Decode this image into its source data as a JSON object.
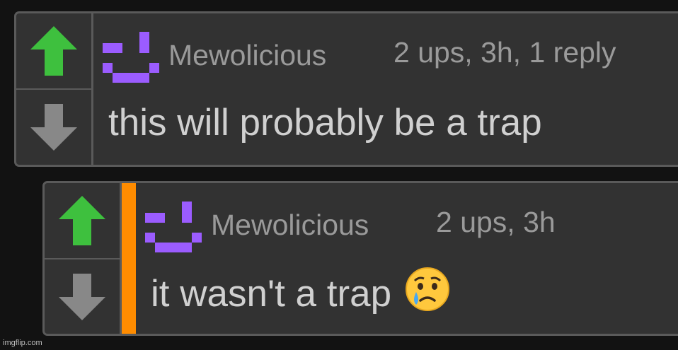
{
  "comments": [
    {
      "username": "Mewolicious",
      "meta": "2 ups, 3h, 1 reply",
      "text": "this will probably be a trap",
      "is_reply": false
    },
    {
      "username": "Mewolicious",
      "meta": "2 ups, 3h",
      "text": "it wasn't a trap",
      "emoji": "crying-face-emoji",
      "is_reply": true
    }
  ],
  "watermark": "imgflip.com",
  "colors": {
    "background": "#121212",
    "card": "#323232",
    "border": "#5a5a5a",
    "upvote": "#3ec03e",
    "downvote": "#888888",
    "avatar": "#9b5cff",
    "reply_bar": "#ff8c00"
  }
}
